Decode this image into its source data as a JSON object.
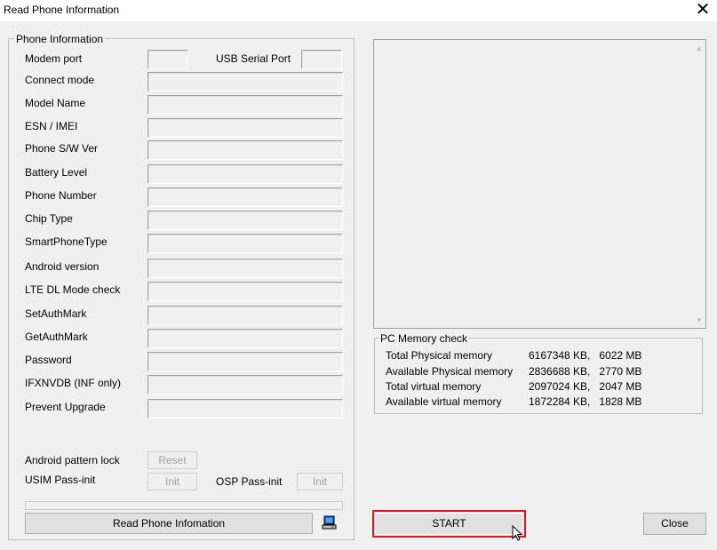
{
  "window": {
    "title": "Read Phone Information",
    "close_glyph": "✕"
  },
  "phone_info": {
    "legend": "Phone Information",
    "modem_port_label": "Modem port",
    "usb_serial_port_label": "USB Serial Port",
    "rows": [
      {
        "label": "Connect mode",
        "value": ""
      },
      {
        "label": "Model Name",
        "value": ""
      },
      {
        "label": "ESN / IMEI",
        "value": ""
      },
      {
        "label": "Phone S/W Ver",
        "value": ""
      },
      {
        "label": "Battery Level",
        "value": ""
      },
      {
        "label": "Phone Number",
        "value": ""
      },
      {
        "label": "Chip Type",
        "value": ""
      },
      {
        "label": "SmartPhoneType",
        "value": ""
      },
      {
        "label": "Android version",
        "value": ""
      },
      {
        "label": "LTE DL Mode check",
        "value": ""
      },
      {
        "label": "SetAuthMark",
        "value": ""
      },
      {
        "label": "GetAuthMark",
        "value": ""
      },
      {
        "label": "Password",
        "value": ""
      },
      {
        "label": "IFXNVDB (INF only)",
        "value": ""
      },
      {
        "label": "Prevent Upgrade",
        "value": ""
      }
    ],
    "android_pattern_lock_label": "Android pattern lock",
    "reset_button": "Reset",
    "usim_pass_init_label": "USIM Pass-init",
    "usim_init_button": "Init",
    "osp_pass_init_label": "OSP Pass-init",
    "osp_init_button": "Init",
    "read_button": "Read Phone Infomation",
    "pc_icon": "computer-icon"
  },
  "memory": {
    "legend": "PC Memory check",
    "rows": [
      {
        "label": "Total Physical memory",
        "value": "6167348 KB,   6022 MB"
      },
      {
        "label": "Available Physical memory",
        "value": "2836688 KB,   2770 MB"
      },
      {
        "label": "Total virtual memory",
        "value": "2097024 KB,   2047 MB"
      },
      {
        "label": "Available virtual memory",
        "value": "1872284 KB,   1828 MB"
      }
    ]
  },
  "actions": {
    "start_button": "START",
    "close_button": "Close"
  },
  "colors": {
    "highlight": "#e81123",
    "background": "#f0f0f0"
  }
}
